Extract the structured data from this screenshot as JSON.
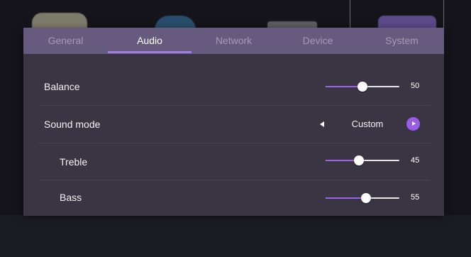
{
  "tabs": [
    {
      "label": "General",
      "active": false
    },
    {
      "label": "Audio",
      "active": true
    },
    {
      "label": "Network",
      "active": false
    },
    {
      "label": "Device",
      "active": false
    },
    {
      "label": "System",
      "active": false
    }
  ],
  "audio": {
    "balance": {
      "label": "Balance",
      "value": 50
    },
    "sound_mode": {
      "label": "Sound mode",
      "value": "Custom"
    },
    "treble": {
      "label": "Treble",
      "value": 45
    },
    "bass": {
      "label": "Bass",
      "value": 55
    }
  },
  "colors": {
    "tab_bar": "#665b7e",
    "panel": "#3a3543",
    "accent": "#a060ee",
    "active_tab_text": "#ffffff",
    "inactive_tab_text": "#a39bb5"
  }
}
